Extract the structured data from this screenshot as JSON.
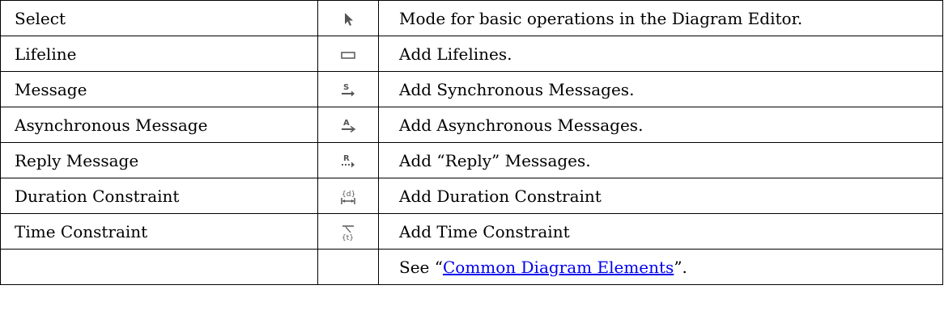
{
  "rows": [
    {
      "tool": "Select",
      "icon": "pointer-arrow-icon",
      "description": "Mode for basic operations in the Diagram Editor."
    },
    {
      "tool": "Lifeline",
      "icon": "rectangle-icon",
      "description": "Add Lifelines."
    },
    {
      "tool": "Message",
      "icon": "synchronous-message-icon",
      "icon_text": "S",
      "description": "Add Synchronous Messages."
    },
    {
      "tool": "Asynchronous Message",
      "icon": "asynchronous-message-icon",
      "icon_text": "A",
      "description": "Add Asynchronous Messages."
    },
    {
      "tool": "Reply Message",
      "icon": "reply-message-icon",
      "icon_text": "R",
      "description": "Add “Reply” Messages."
    },
    {
      "tool": "Duration Constraint",
      "icon": "duration-constraint-icon",
      "icon_text": "{d}",
      "description": "Add Duration Constraint"
    },
    {
      "tool": "Time Constraint",
      "icon": "time-constraint-icon",
      "icon_text": "{t}",
      "description": "Add Time Constraint"
    }
  ],
  "footer_row": {
    "prefix": "See “",
    "link_text": "Common Diagram Elements",
    "suffix": "”."
  },
  "colors": {
    "border": "#000000",
    "icon_gray": "#555555",
    "link": "#0000ee"
  }
}
